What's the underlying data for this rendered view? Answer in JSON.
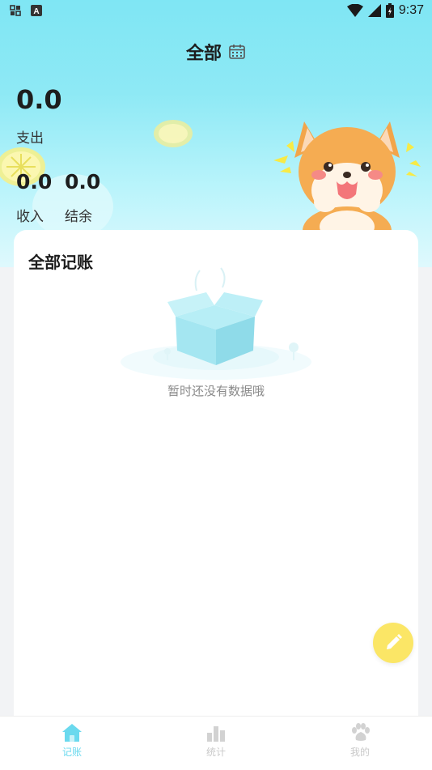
{
  "status_bar": {
    "time": "9:37",
    "left_icons": [
      "notification-grid-icon",
      "a-icon"
    ],
    "right_icons": [
      "wifi-icon",
      "signal-icon",
      "battery-icon"
    ]
  },
  "header": {
    "title": "全部",
    "calendar_icon": "calendar-icon"
  },
  "summary": {
    "expense_value": "0.0",
    "expense_label": "支出",
    "income_value": "0.0",
    "income_label": "收入",
    "balance_value": "0.0",
    "balance_label": "结余"
  },
  "records": {
    "title": "全部记账",
    "empty_text": "暂时还没有数据哦"
  },
  "fab": {
    "icon": "pencil-icon"
  },
  "tabbar": {
    "items": [
      {
        "label": "记账",
        "icon": "home-icon",
        "active": true
      },
      {
        "label": "统计",
        "icon": "bar-chart-icon",
        "active": false
      },
      {
        "label": "我的",
        "icon": "paw-icon",
        "active": false
      }
    ]
  },
  "colors": {
    "accent": "#6ad9ee",
    "fab": "#fbe666",
    "hero_top": "#7fe6f4"
  }
}
